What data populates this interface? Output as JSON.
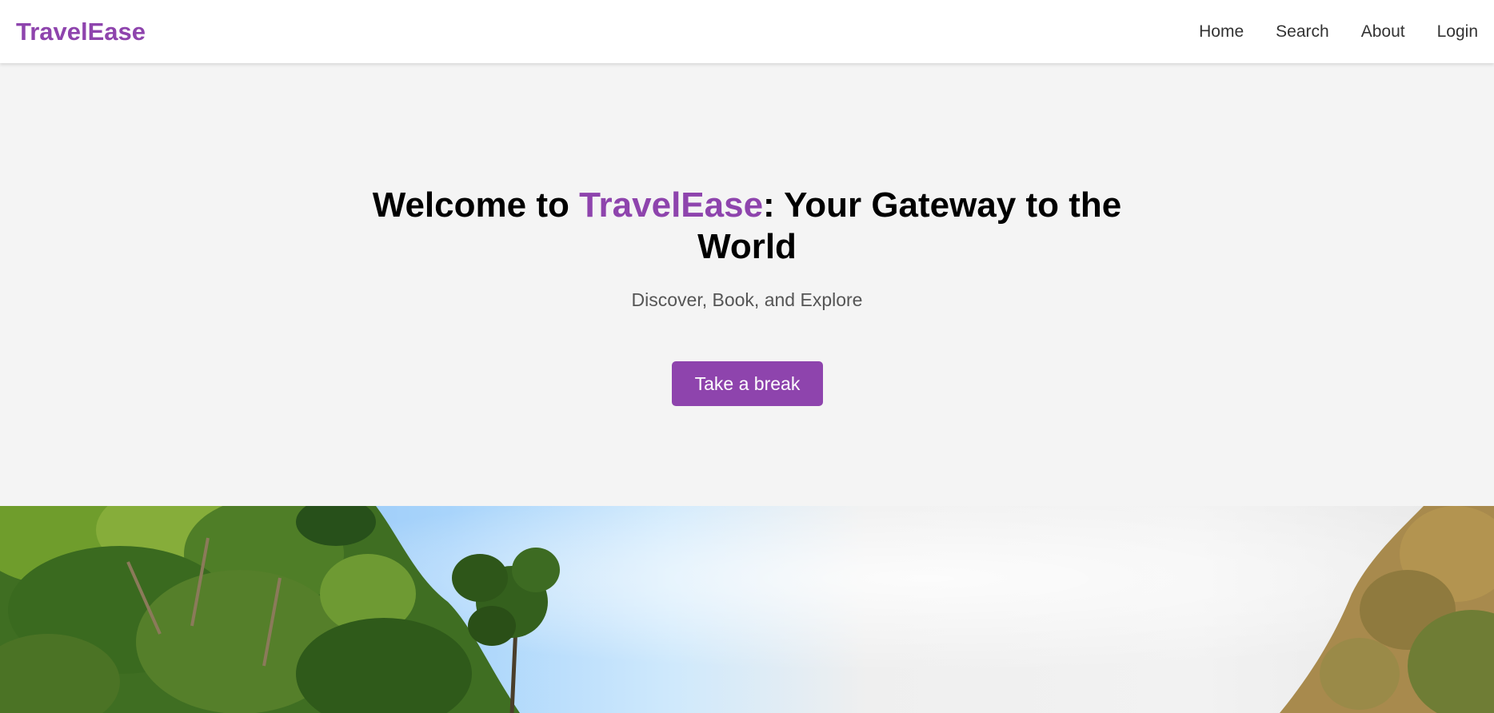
{
  "brand": {
    "name": "TravelEase",
    "color": "#8e44ad"
  },
  "nav": {
    "items": [
      {
        "label": "Home"
      },
      {
        "label": "Search"
      },
      {
        "label": "About"
      },
      {
        "label": "Login"
      }
    ]
  },
  "hero": {
    "title_prefix": "Welcome to ",
    "title_brand": "TravelEase",
    "title_suffix": ": Your Gateway to the World",
    "subtitle": "Discover, Book, and Explore",
    "cta_label": "Take a break"
  },
  "scenery": {
    "subject": "forest-canopy-and-sky-photo"
  }
}
